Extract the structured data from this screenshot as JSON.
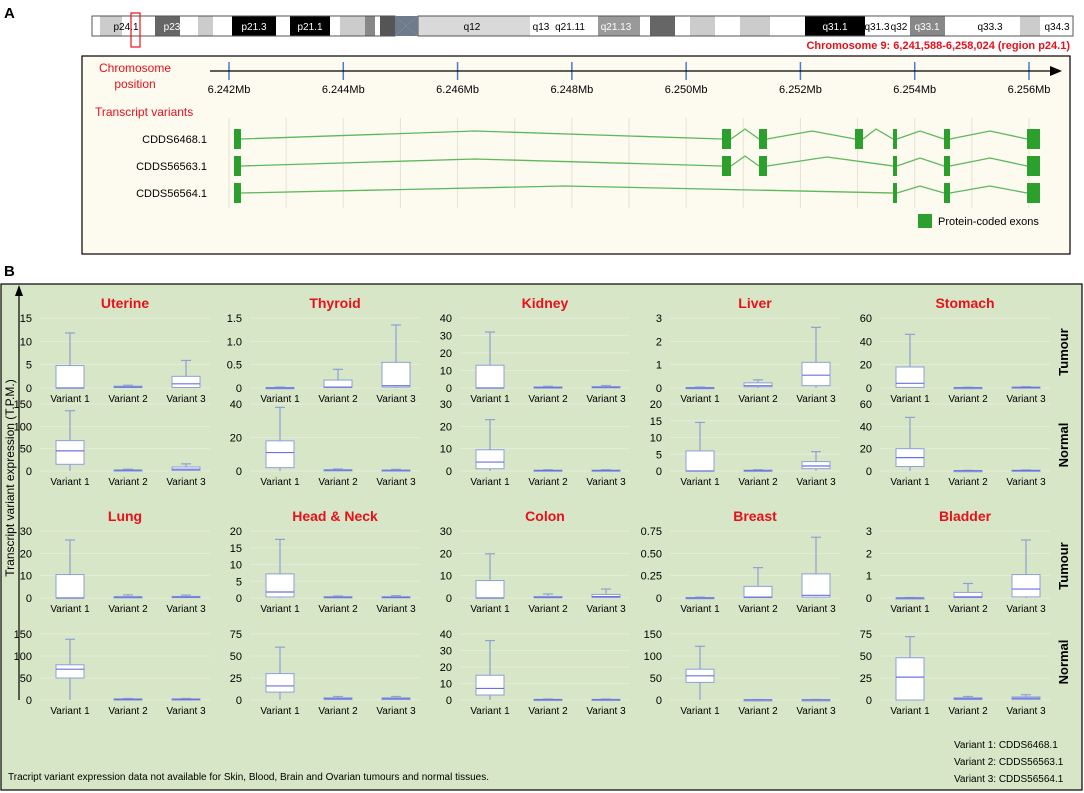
{
  "panels": {
    "a": "A",
    "b": "B"
  },
  "chromosome": {
    "bands": [
      "p24.1",
      "p23",
      "p21.3",
      "p21.1",
      "q12",
      "q13",
      "q21.11",
      "q21.13",
      "q31.1",
      "q31.3",
      "q32",
      "q33.1",
      "q33.3",
      "q34.3"
    ],
    "region_label": "Chromosome 9: 6,241,588-6,258,024 (region p24.1)"
  },
  "gene_track": {
    "position_label": [
      "Chromosome",
      "position"
    ],
    "variants_label": "Transcript variants",
    "ticks": [
      "6.242Mb",
      "6.244Mb",
      "6.246Mb",
      "6.248Mb",
      "6.250Mb",
      "6.252Mb",
      "6.254Mb",
      "6.256Mb"
    ],
    "transcripts": [
      "CDDS6468.1",
      "CDDS56563.1",
      "CDDS56564.1"
    ],
    "legend": "Protein-coded exons",
    "colors": {
      "exon": "#2ca02c",
      "intron": "#5cb85c",
      "label_red": "#e8101a",
      "axis": "#000000"
    }
  },
  "expression": {
    "y_axis_label": "Transcript variant expression (T.P.M.)",
    "row_labels": [
      "Tumour",
      "Normal",
      "Tumour",
      "Normal"
    ],
    "footnote": "Tracript variant expression data not available for Skin, Blood, Brain and Ovarian tumours and normal tissues.",
    "variant_key": [
      "Variant 1: CDDS6468.1",
      "Variant 2: CDDS56563.1",
      "Variant 3: CDDS56564.1"
    ],
    "background": "#d7e6c6",
    "box_stroke": "#8da0d8",
    "median_color": "#6d72e0"
  },
  "chart_data": [
    {
      "type": "box",
      "title": "Uterine",
      "condition": "Tumour",
      "categories": [
        "Variant 1",
        "Variant 2",
        "Variant 3"
      ],
      "yticks": [
        "0",
        "5",
        "10",
        "15"
      ],
      "ylim": [
        0,
        15
      ],
      "boxes": [
        {
          "whislo": 0,
          "q1": 0,
          "med": 0,
          "q3": 4.8,
          "whishi": 11.8
        },
        {
          "whislo": 0,
          "q1": 0.1,
          "med": 0.2,
          "q3": 0.4,
          "whishi": 0.6
        },
        {
          "whislo": 0,
          "q1": 0.1,
          "med": 0.9,
          "q3": 2.5,
          "whishi": 5.9
        }
      ]
    },
    {
      "type": "box",
      "title": "Uterine",
      "condition": "Normal",
      "categories": [
        "Variant 1",
        "Variant 2",
        "Variant 3"
      ],
      "yticks": [
        "0",
        "50",
        "100",
        "150"
      ],
      "ylim": [
        0,
        150
      ],
      "boxes": [
        {
          "whislo": 0,
          "q1": 15,
          "med": 45,
          "q3": 68,
          "whishi": 135
        },
        {
          "whislo": 0,
          "q1": 0.5,
          "med": 1.5,
          "q3": 2.5,
          "whishi": 4
        },
        {
          "whislo": 0,
          "q1": 1,
          "med": 4,
          "q3": 9,
          "whishi": 16
        }
      ]
    },
    {
      "type": "box",
      "title": "Thyroid",
      "condition": "Tumour",
      "categories": [
        "Variant 1",
        "Variant 2",
        "Variant 3"
      ],
      "yticks": [
        "0",
        "0.5",
        "1.0",
        "1.5"
      ],
      "ylim": [
        0,
        1.5
      ],
      "boxes": [
        {
          "whislo": 0,
          "q1": 0,
          "med": 0,
          "q3": 0.01,
          "whishi": 0.02
        },
        {
          "whislo": 0,
          "q1": 0.01,
          "med": 0.02,
          "q3": 0.17,
          "whishi": 0.4
        },
        {
          "whislo": 0,
          "q1": 0.02,
          "med": 0.05,
          "q3": 0.55,
          "whishi": 1.35
        }
      ]
    },
    {
      "type": "box",
      "title": "Thyroid",
      "condition": "Normal",
      "categories": [
        "Variant 1",
        "Variant 2",
        "Variant 3"
      ],
      "yticks": [
        "0",
        "20",
        "40"
      ],
      "ylim": [
        0,
        40
      ],
      "boxes": [
        {
          "whislo": 0,
          "q1": 2,
          "med": 11,
          "q3": 18,
          "whishi": 38
        },
        {
          "whislo": 0,
          "q1": 0.2,
          "med": 0.5,
          "q3": 0.8,
          "whishi": 1.2
        },
        {
          "whislo": 0,
          "q1": 0.2,
          "med": 0.4,
          "q3": 0.6,
          "whishi": 1
        }
      ]
    },
    {
      "type": "box",
      "title": "Kidney",
      "condition": "Tumour",
      "categories": [
        "Variant 1",
        "Variant 2",
        "Variant 3"
      ],
      "yticks": [
        "0",
        "10",
        "20",
        "30",
        "40"
      ],
      "ylim": [
        0,
        40
      ],
      "boxes": [
        {
          "whislo": 0,
          "q1": 0,
          "med": 0,
          "q3": 13,
          "whishi": 32
        },
        {
          "whislo": 0,
          "q1": 0.1,
          "med": 0.3,
          "q3": 0.6,
          "whishi": 1
        },
        {
          "whislo": 0,
          "q1": 0.1,
          "med": 0.4,
          "q3": 0.8,
          "whishi": 1.4
        }
      ]
    },
    {
      "type": "box",
      "title": "Kidney",
      "condition": "Normal",
      "categories": [
        "Variant 1",
        "Variant 2",
        "Variant 3"
      ],
      "yticks": [
        "0",
        "10",
        "20",
        "30"
      ],
      "ylim": [
        0,
        30
      ],
      "boxes": [
        {
          "whislo": 0,
          "q1": 1,
          "med": 4,
          "q3": 9.5,
          "whishi": 23
        },
        {
          "whislo": 0,
          "q1": 0.1,
          "med": 0.2,
          "q3": 0.4,
          "whishi": 0.6
        },
        {
          "whislo": 0,
          "q1": 0.1,
          "med": 0.2,
          "q3": 0.4,
          "whishi": 0.6
        }
      ]
    },
    {
      "type": "box",
      "title": "Liver",
      "condition": "Tumour",
      "categories": [
        "Variant 1",
        "Variant 2",
        "Variant 3"
      ],
      "yticks": [
        "0",
        "1",
        "2",
        "3"
      ],
      "ylim": [
        0,
        3
      ],
      "boxes": [
        {
          "whislo": 0,
          "q1": 0,
          "med": 0,
          "q3": 0.02,
          "whishi": 0.04
        },
        {
          "whislo": 0,
          "q1": 0.05,
          "med": 0.1,
          "q3": 0.22,
          "whishi": 0.35
        },
        {
          "whislo": 0,
          "q1": 0.1,
          "med": 0.55,
          "q3": 1.1,
          "whishi": 2.6
        }
      ]
    },
    {
      "type": "box",
      "title": "Liver",
      "condition": "Normal",
      "categories": [
        "Variant 1",
        "Variant 2",
        "Variant 3"
      ],
      "yticks": [
        "0",
        "5",
        "10",
        "15",
        "20"
      ],
      "ylim": [
        0,
        20
      ],
      "boxes": [
        {
          "whislo": 0,
          "q1": 0,
          "med": 0,
          "q3": 6,
          "whishi": 14.5
        },
        {
          "whislo": 0,
          "q1": 0.05,
          "med": 0.1,
          "q3": 0.25,
          "whishi": 0.4
        },
        {
          "whislo": 0,
          "q1": 0.7,
          "med": 1.5,
          "q3": 2.8,
          "whishi": 5.8
        }
      ]
    },
    {
      "type": "box",
      "title": "Stomach",
      "condition": "Tumour",
      "categories": [
        "Variant 1",
        "Variant 2",
        "Variant 3"
      ],
      "yticks": [
        "0",
        "20",
        "40",
        "60"
      ],
      "ylim": [
        0,
        60
      ],
      "boxes": [
        {
          "whislo": 0,
          "q1": 0.5,
          "med": 4,
          "q3": 18,
          "whishi": 46
        },
        {
          "whislo": 0,
          "q1": 0.1,
          "med": 0.2,
          "q3": 0.4,
          "whishi": 0.6
        },
        {
          "whislo": 0,
          "q1": 0.2,
          "med": 0.5,
          "q3": 0.8,
          "whishi": 1.2
        }
      ]
    },
    {
      "type": "box",
      "title": "Stomach",
      "condition": "Normal",
      "categories": [
        "Variant 1",
        "Variant 2",
        "Variant 3"
      ],
      "yticks": [
        "0",
        "20",
        "40",
        "60"
      ],
      "ylim": [
        0,
        60
      ],
      "boxes": [
        {
          "whislo": 0,
          "q1": 4,
          "med": 12,
          "q3": 20,
          "whishi": 48
        },
        {
          "whislo": 0,
          "q1": 0.1,
          "med": 0.2,
          "q3": 0.4,
          "whishi": 0.6
        },
        {
          "whislo": 0,
          "q1": 0.2,
          "med": 0.4,
          "q3": 0.7,
          "whishi": 1
        }
      ]
    },
    {
      "type": "box",
      "title": "Lung",
      "condition": "Tumour",
      "categories": [
        "Variant 1",
        "Variant 2",
        "Variant 3"
      ],
      "yticks": [
        "0",
        "10",
        "20",
        "30"
      ],
      "ylim": [
        0,
        30
      ],
      "boxes": [
        {
          "whislo": 0,
          "q1": 0,
          "med": 0,
          "q3": 10.5,
          "whishi": 26
        },
        {
          "whislo": 0,
          "q1": 0.2,
          "med": 0.4,
          "q3": 0.6,
          "whishi": 1.4
        },
        {
          "whislo": 0,
          "q1": 0.2,
          "med": 0.4,
          "q3": 0.7,
          "whishi": 1.3
        }
      ]
    },
    {
      "type": "box",
      "title": "Lung",
      "condition": "Normal",
      "categories": [
        "Variant 1",
        "Variant 2",
        "Variant 3"
      ],
      "yticks": [
        "0",
        "50",
        "100",
        "150"
      ],
      "ylim": [
        0,
        150
      ],
      "boxes": [
        {
          "whislo": 0,
          "q1": 50,
          "med": 70,
          "q3": 80,
          "whishi": 138
        },
        {
          "whislo": 0,
          "q1": 0.5,
          "med": 1.5,
          "q3": 2.5,
          "whishi": 3.5
        },
        {
          "whislo": 0,
          "q1": 0.5,
          "med": 1.5,
          "q3": 2.5,
          "whishi": 3.5
        }
      ]
    },
    {
      "type": "box",
      "title": "Head & Neck",
      "condition": "Tumour",
      "categories": [
        "Variant 1",
        "Variant 2",
        "Variant 3"
      ],
      "yticks": [
        "0",
        "5",
        "10",
        "15",
        "20"
      ],
      "ylim": [
        0,
        20
      ],
      "boxes": [
        {
          "whislo": 0,
          "q1": 0.3,
          "med": 1.8,
          "q3": 7.2,
          "whishi": 17.5
        },
        {
          "whislo": 0,
          "q1": 0.1,
          "med": 0.2,
          "q3": 0.4,
          "whishi": 0.6
        },
        {
          "whislo": 0,
          "q1": 0.1,
          "med": 0.2,
          "q3": 0.4,
          "whishi": 0.7
        }
      ]
    },
    {
      "type": "box",
      "title": "Head & Neck",
      "condition": "Normal",
      "categories": [
        "Variant 1",
        "Variant 2",
        "Variant 3"
      ],
      "yticks": [
        "0",
        "25",
        "50",
        "75"
      ],
      "ylim": [
        0,
        75
      ],
      "boxes": [
        {
          "whislo": 0,
          "q1": 9,
          "med": 16,
          "q3": 30,
          "whishi": 60
        },
        {
          "whislo": 0,
          "q1": 0.5,
          "med": 1.5,
          "q3": 2.5,
          "whishi": 4
        },
        {
          "whislo": 0,
          "q1": 0.5,
          "med": 1.5,
          "q3": 2.5,
          "whishi": 4
        }
      ]
    },
    {
      "type": "box",
      "title": "Colon",
      "condition": "Tumour",
      "categories": [
        "Variant 1",
        "Variant 2",
        "Variant 3"
      ],
      "yticks": [
        "0",
        "10",
        "20",
        "30"
      ],
      "ylim": [
        0,
        30
      ],
      "boxes": [
        {
          "whislo": 0,
          "q1": 0,
          "med": 0,
          "q3": 7.8,
          "whishi": 19.8
        },
        {
          "whislo": 0,
          "q1": 0.1,
          "med": 0.3,
          "q3": 0.7,
          "whishi": 1.8
        },
        {
          "whislo": 0,
          "q1": 0.2,
          "med": 0.6,
          "q3": 1.6,
          "whishi": 4
        }
      ]
    },
    {
      "type": "box",
      "title": "Colon",
      "condition": "Normal",
      "categories": [
        "Variant 1",
        "Variant 2",
        "Variant 3"
      ],
      "yticks": [
        "0",
        "10",
        "20",
        "30",
        "40"
      ],
      "ylim": [
        0,
        40
      ],
      "boxes": [
        {
          "whislo": 0,
          "q1": 3,
          "med": 7,
          "q3": 15,
          "whishi": 36
        },
        {
          "whislo": 0,
          "q1": 0.1,
          "med": 0.2,
          "q3": 0.4,
          "whishi": 0.6
        },
        {
          "whislo": 0,
          "q1": 0.1,
          "med": 0.2,
          "q3": 0.4,
          "whishi": 0.6
        }
      ]
    },
    {
      "type": "box",
      "title": "Breast",
      "condition": "Tumour",
      "categories": [
        "Variant 1",
        "Variant 2",
        "Variant 3"
      ],
      "yticks": [
        "0",
        "0.25",
        "0.50",
        "0.75"
      ],
      "ylim": [
        0,
        0.75
      ],
      "boxes": [
        {
          "whislo": 0,
          "q1": 0,
          "med": 0,
          "q3": 0.005,
          "whishi": 0.01
        },
        {
          "whislo": 0,
          "q1": 0.005,
          "med": 0.01,
          "q3": 0.13,
          "whishi": 0.34
        },
        {
          "whislo": 0,
          "q1": 0.01,
          "med": 0.03,
          "q3": 0.27,
          "whishi": 0.68
        }
      ]
    },
    {
      "type": "box",
      "title": "Breast",
      "condition": "Normal",
      "categories": [
        "Variant 1",
        "Variant 2",
        "Variant 3"
      ],
      "yticks": [
        "0",
        "50",
        "100",
        "150"
      ],
      "ylim": [
        0,
        150
      ],
      "boxes": [
        {
          "whislo": 0,
          "q1": 40,
          "med": 55,
          "q3": 70,
          "whishi": 122
        },
        {
          "whislo": 0,
          "q1": 0.2,
          "med": 0.4,
          "q3": 0.6,
          "whishi": 1
        },
        {
          "whislo": 0,
          "q1": 0.2,
          "med": 0.4,
          "q3": 0.6,
          "whishi": 1.2
        }
      ]
    },
    {
      "type": "box",
      "title": "Bladder",
      "condition": "Tumour",
      "categories": [
        "Variant 1",
        "Variant 2",
        "Variant 3"
      ],
      "yticks": [
        "0",
        "1",
        "2",
        "3"
      ],
      "ylim": [
        0,
        3
      ],
      "boxes": [
        {
          "whislo": 0,
          "q1": 0,
          "med": 0,
          "q3": 0.01,
          "whishi": 0.02
        },
        {
          "whislo": 0,
          "q1": 0.02,
          "med": 0.05,
          "q3": 0.25,
          "whishi": 0.65
        },
        {
          "whislo": 0,
          "q1": 0.05,
          "med": 0.4,
          "q3": 1.05,
          "whishi": 2.6
        }
      ]
    },
    {
      "type": "box",
      "title": "Bladder",
      "condition": "Normal",
      "categories": [
        "Variant 1",
        "Variant 2",
        "Variant 3"
      ],
      "yticks": [
        "0",
        "25",
        "50",
        "75"
      ],
      "ylim": [
        0,
        75
      ],
      "boxes": [
        {
          "whislo": 0,
          "q1": 0,
          "med": 26,
          "q3": 48,
          "whishi": 72
        },
        {
          "whislo": 0,
          "q1": 0.5,
          "med": 1.5,
          "q3": 2.5,
          "whishi": 4
        },
        {
          "whislo": 0,
          "q1": 0.5,
          "med": 2,
          "q3": 3.5,
          "whishi": 6
        }
      ]
    }
  ]
}
